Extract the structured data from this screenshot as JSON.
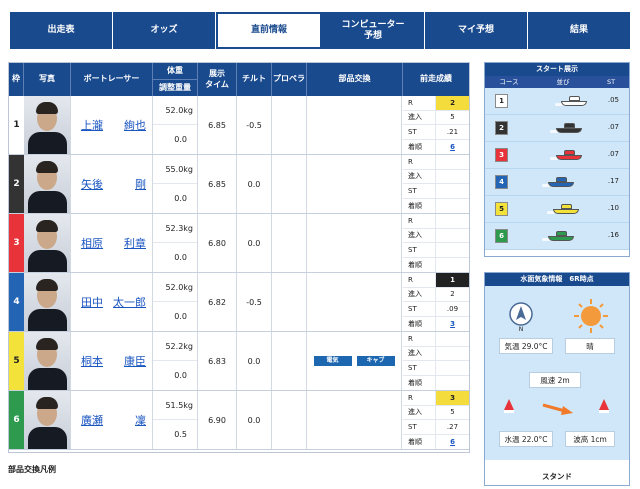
{
  "tabs": [
    {
      "label": "出走表"
    },
    {
      "label": "オッズ"
    },
    {
      "label": "直前情報"
    },
    {
      "label": "コンピューター\n予想"
    },
    {
      "label": "マイ予想"
    },
    {
      "label": "結果"
    }
  ],
  "table": {
    "headers": {
      "waku": "枠",
      "photo": "写真",
      "racer": "ボートレーサー",
      "weight": "体重",
      "adjust": "調整重量",
      "exhibit": "展示\nタイム",
      "tilt": "チルト",
      "propeller": "プロペラ",
      "parts": "部品交換",
      "prev": "前走成績"
    },
    "prev_labels": [
      "R",
      "進入",
      "ST",
      "着順"
    ],
    "rows": [
      {
        "waku": "1",
        "color": "#ffffff",
        "text": "#222222",
        "name_family": "上瀧",
        "name_given": "絢也",
        "weight": "52.0kg",
        "adjust": "0.0",
        "exhibit": "6.85",
        "tilt": "-0.5",
        "parts": [],
        "prev": {
          "r": "2",
          "shinnyu": "5",
          "st": ".21",
          "chaku": "6"
        }
      },
      {
        "waku": "2",
        "color": "#333333",
        "text": "#ffffff",
        "name_family": "矢後",
        "name_given": "剛",
        "weight": "55.0kg",
        "adjust": "0.0",
        "exhibit": "6.85",
        "tilt": "0.0",
        "parts": [],
        "prev": {
          "r": "",
          "shinnyu": "",
          "st": "",
          "chaku": ""
        }
      },
      {
        "waku": "3",
        "color": "#e8333a",
        "text": "#ffffff",
        "name_family": "相原",
        "name_given": "利章",
        "weight": "52.3kg",
        "adjust": "0.0",
        "exhibit": "6.80",
        "tilt": "0.0",
        "parts": [],
        "prev": {
          "r": "",
          "shinnyu": "",
          "st": "",
          "chaku": ""
        }
      },
      {
        "waku": "4",
        "color": "#2464b4",
        "text": "#ffffff",
        "name_family": "田中",
        "name_given": "太一郎",
        "weight": "52.0kg",
        "adjust": "0.0",
        "exhibit": "6.82",
        "tilt": "-0.5",
        "parts": [],
        "prev": {
          "r": "1",
          "shinnyu": "2",
          "st": ".09",
          "chaku": "3"
        }
      },
      {
        "waku": "5",
        "color": "#f2e23a",
        "text": "#222222",
        "name_family": "桐本",
        "name_given": "康臣",
        "weight": "52.2kg",
        "adjust": "0.0",
        "exhibit": "6.83",
        "tilt": "0.0",
        "parts": [
          "電気",
          "キャブ"
        ],
        "prev": {
          "r": "",
          "shinnyu": "",
          "st": "",
          "chaku": ""
        }
      },
      {
        "waku": "6",
        "color": "#2d9a4e",
        "text": "#ffffff",
        "name_family": "廣瀬",
        "name_given": "凜",
        "weight": "51.5kg",
        "adjust": "0.5",
        "exhibit": "6.90",
        "tilt": "0.0",
        "parts": [],
        "prev": {
          "r": "3",
          "shinnyu": "5",
          "st": ".27",
          "chaku": "6"
        }
      }
    ],
    "legend": "部品交換凡例"
  },
  "start": {
    "title": "スタート展示",
    "headers": [
      "コース",
      "並び",
      "ST"
    ],
    "rows": [
      {
        "course": "1",
        "color": "#ffffff",
        "text": "#222222",
        "boat_color": "#ffffff",
        "st": ".05",
        "pos": 0.55
      },
      {
        "course": "2",
        "color": "#333333",
        "text": "#ffffff",
        "boat_color": "#333333",
        "st": ".07",
        "pos": 0.45
      },
      {
        "course": "3",
        "color": "#e8333a",
        "text": "#ffffff",
        "boat_color": "#e8333a",
        "st": ".07",
        "pos": 0.45
      },
      {
        "course": "4",
        "color": "#2464b4",
        "text": "#ffffff",
        "boat_color": "#2464b4",
        "st": ".17",
        "pos": 0.3
      },
      {
        "course": "5",
        "color": "#f2e23a",
        "text": "#222222",
        "boat_color": "#f2e23a",
        "st": ".10",
        "pos": 0.4
      },
      {
        "course": "6",
        "color": "#2d9a4e",
        "text": "#ffffff",
        "boat_color": "#2d9a4e",
        "st": ".16",
        "pos": 0.3
      }
    ]
  },
  "weather": {
    "title": "水面気象情報　6R時点",
    "compass_label": "N",
    "air_temp": "気温 29.0°C",
    "condition": "晴",
    "wind": "風速 2m",
    "water_temp": "水温 22.0°C",
    "wave": "波高 1cm",
    "stand": "スタンド"
  }
}
